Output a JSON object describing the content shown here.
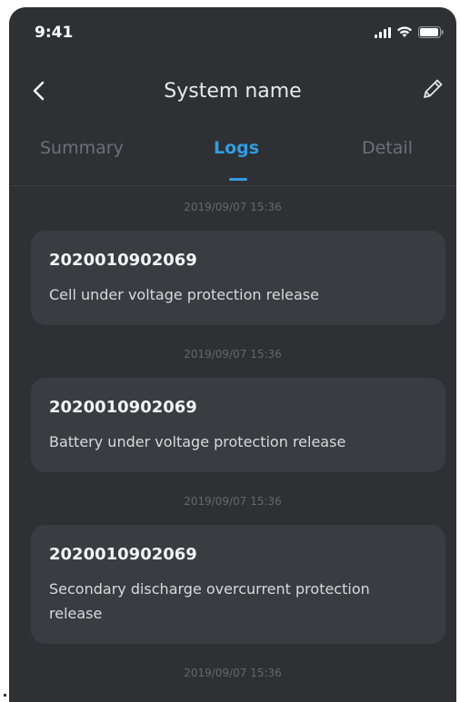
{
  "status_bar": {
    "time": "9:41",
    "icons": [
      "signal-icon",
      "wifi-icon",
      "battery-icon"
    ]
  },
  "nav": {
    "title": "System name",
    "back_icon": "chevron-left-icon",
    "edit_icon": "pencil-icon"
  },
  "tabs": [
    {
      "label": "Summary",
      "active": false
    },
    {
      "label": "Logs",
      "active": true
    },
    {
      "label": "Detail",
      "active": false
    }
  ],
  "logs": [
    {
      "time": "2019/09/07  15:36",
      "id": "2020010902069",
      "message": "Cell under voltage protection release"
    },
    {
      "time": "2019/09/07  15:36",
      "id": "2020010902069",
      "message": "Battery under voltage protection release"
    },
    {
      "time": "2019/09/07  15:36",
      "id": "2020010902069",
      "message": "Secondary discharge overcurrent protection release"
    },
    {
      "time": "2019/09/07  15:36",
      "id": "",
      "message": ""
    }
  ],
  "colors": {
    "background": "#2f3034",
    "card": "#3b3c41",
    "accent": "#2f9ee3",
    "inactive_tab": "#6f7075"
  }
}
